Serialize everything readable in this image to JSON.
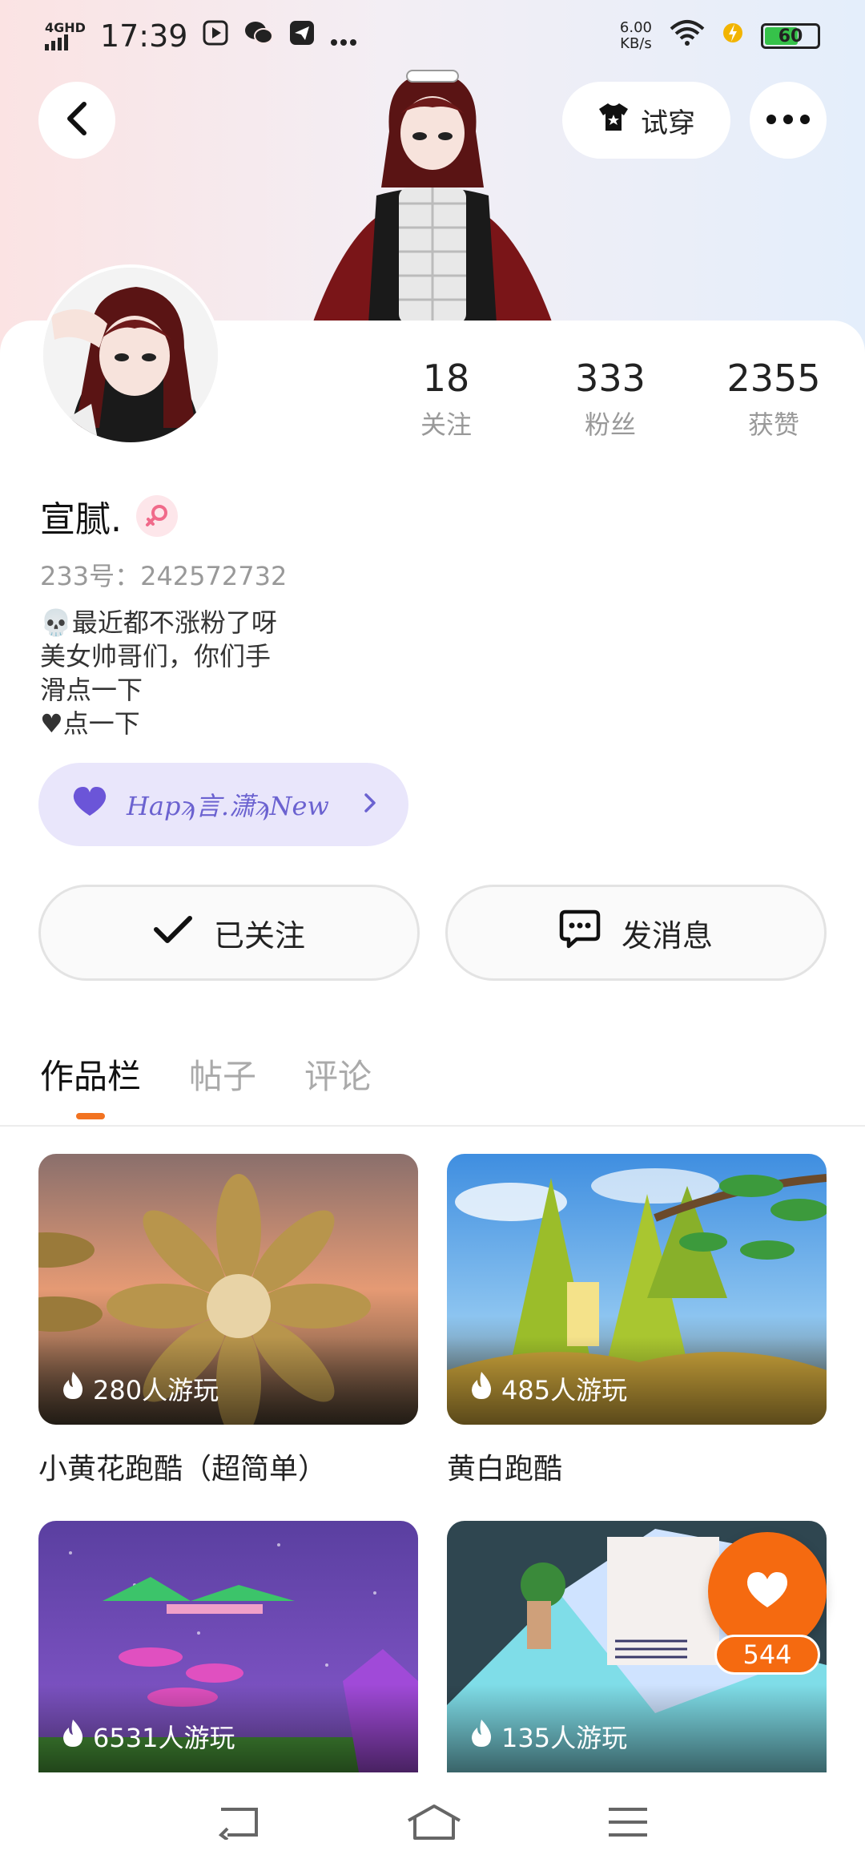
{
  "status_bar": {
    "network": "4GHD",
    "time": "17:39",
    "speed_value": "6.00",
    "speed_unit": "KB/s",
    "battery": "60"
  },
  "header": {
    "try_on_label": "试穿"
  },
  "profile": {
    "stats": [
      {
        "value": "18",
        "label": "关注"
      },
      {
        "value": "333",
        "label": "粉丝"
      },
      {
        "value": "2355",
        "label": "获赞"
      }
    ],
    "name": "宣腻.",
    "uid": "233号：242572732",
    "bio": "💀最近都不涨粉了呀\n美女帅哥们，你们手\n滑点一下\n♥点一下",
    "clan": "Hapϡ言.潇ϡNew"
  },
  "actions": {
    "followed_label": "已关注",
    "message_label": "发消息"
  },
  "tabs": [
    {
      "label": "作品栏",
      "active": true
    },
    {
      "label": "帖子",
      "active": false
    },
    {
      "label": "评论",
      "active": false
    }
  ],
  "games": [
    {
      "plays": "280人游玩",
      "title": "小黄花跑酷（超简单）"
    },
    {
      "plays": "485人游玩",
      "title": "黄白跑酷"
    },
    {
      "plays": "6531人游玩",
      "title": ""
    },
    {
      "plays": "135人游玩",
      "title": ""
    }
  ],
  "like": {
    "count": "544"
  },
  "colors": {
    "accent": "#f56a10",
    "clan_bg": "#e9e6fb",
    "clan_text": "#6b62d0"
  }
}
